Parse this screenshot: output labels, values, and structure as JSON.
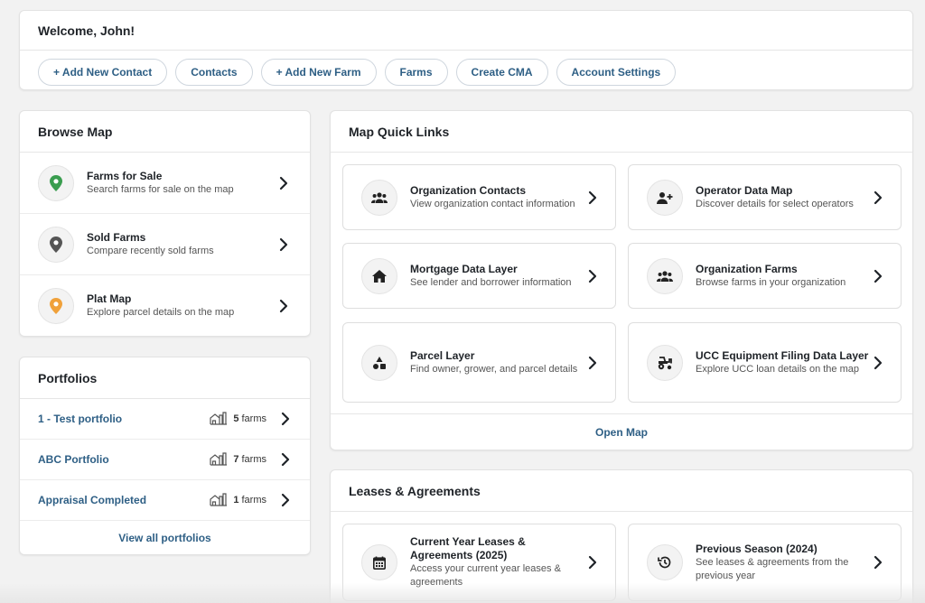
{
  "welcome": {
    "title": "Welcome, John!",
    "buttons": [
      {
        "label": "+ Add New Contact"
      },
      {
        "label": "Contacts"
      },
      {
        "label": "+ Add New Farm"
      },
      {
        "label": "Farms"
      },
      {
        "label": "Create CMA"
      },
      {
        "label": "Account Settings"
      }
    ]
  },
  "browse_map": {
    "title": "Browse Map",
    "items": [
      {
        "title": "Farms for Sale",
        "subtitle": "Search farms for sale on the map",
        "icon": "map-pin-icon",
        "color": "#3a9d4f"
      },
      {
        "title": "Sold Farms",
        "subtitle": "Compare recently sold farms",
        "icon": "map-pin-icon",
        "color": "#555555"
      },
      {
        "title": "Plat Map",
        "subtitle": "Explore parcel details on the map",
        "icon": "map-pin-icon",
        "color": "#f0a13a"
      }
    ]
  },
  "portfolios": {
    "title": "Portfolios",
    "items": [
      {
        "name": "1 - Test portfolio",
        "count": "5",
        "unit": "farms"
      },
      {
        "name": "ABC Portfolio",
        "count": "7",
        "unit": "farms"
      },
      {
        "name": "Appraisal Completed",
        "count": "1",
        "unit": "farms"
      }
    ],
    "view_all": "View all portfolios"
  },
  "map_quick_links": {
    "title": "Map Quick Links",
    "tiles": [
      {
        "title": "Organization Contacts",
        "subtitle": "View organization contact information",
        "icon": "users-icon"
      },
      {
        "title": "Operator Data Map",
        "subtitle": "Discover details for select operators",
        "icon": "user-plus-icon"
      },
      {
        "title": "Mortgage Data Layer",
        "subtitle": "See lender and borrower information",
        "icon": "home-icon"
      },
      {
        "title": "Organization Farms",
        "subtitle": "Browse farms in your organization",
        "icon": "users-icon"
      },
      {
        "title": "Parcel Layer",
        "subtitle": "Find owner, grower, and parcel details",
        "icon": "shapes-icon"
      },
      {
        "title": "UCC Equipment Filing Data Layer",
        "subtitle": "Explore UCC loan details on the map",
        "icon": "tractor-icon"
      }
    ],
    "open_map": "Open Map"
  },
  "leases": {
    "title": "Leases & Agreements",
    "tiles": [
      {
        "title": "Current Year Leases & Agreements (2025)",
        "subtitle": "Access your current year leases & agreements",
        "icon": "calendar-icon"
      },
      {
        "title": "Previous Season (2024)",
        "subtitle": "See leases & agreements from the previous year",
        "icon": "history-icon"
      }
    ]
  },
  "colors": {
    "link": "#2e5f85",
    "background": "#f2f2f2"
  }
}
